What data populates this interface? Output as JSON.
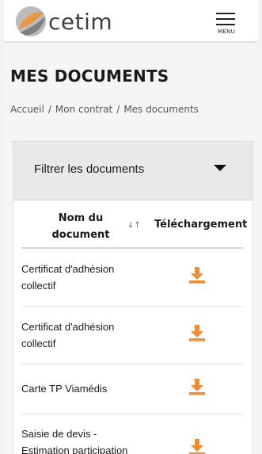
{
  "header": {
    "logo_text": "cetim",
    "menu_label": "MENU"
  },
  "page": {
    "title": "MES DOCUMENTS"
  },
  "breadcrumb": {
    "items": [
      "Accueil",
      "Mon contrat",
      "Mes documents"
    ],
    "separator": "/"
  },
  "filter": {
    "label": "Filtrer les documents"
  },
  "table": {
    "columns": {
      "name_line1": "Nom du",
      "name_line2": "document",
      "sort_glyph": "↓↑",
      "download": "Téléchargement"
    },
    "rows": [
      {
        "line1": "Certificat d'adhésion",
        "line2": "collectif",
        "download_icon": "download-icon"
      },
      {
        "line1": "Certificat d'adhésion",
        "line2": "collectif",
        "download_icon": "download-icon"
      },
      {
        "line1": "Carte TP Viamédis",
        "line2": "",
        "download_icon": "download-icon"
      },
      {
        "line1": "Saisie de devis -",
        "line2": "Estimation participation",
        "download_icon": "download-icon"
      }
    ]
  },
  "colors": {
    "accent_orange": "#f08c32",
    "text": "#1a1a1a",
    "filter_bg": "#e9e9e9"
  }
}
